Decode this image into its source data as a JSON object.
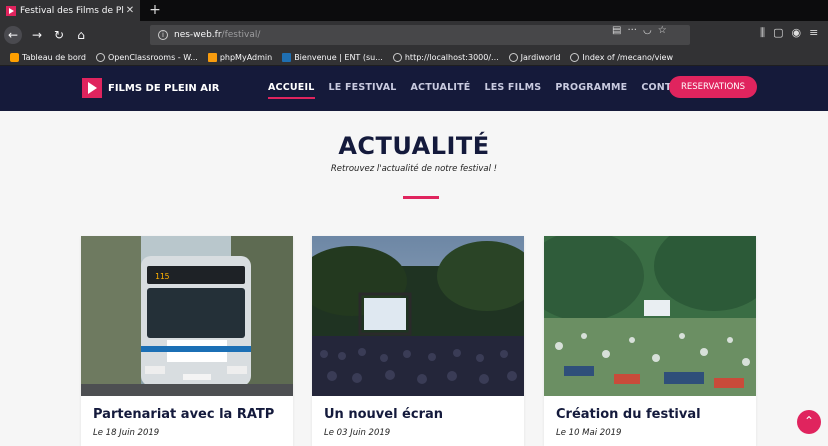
{
  "browser": {
    "tab_title": "Festival des Films de Plein Air",
    "tab_close": "✕",
    "new_tab": "+",
    "url_host": "nes-web.fr",
    "url_path": "/festival/",
    "bookmarks": [
      {
        "label": "Tableau de bord"
      },
      {
        "label": "OpenClassrooms - W..."
      },
      {
        "label": "phpMyAdmin"
      },
      {
        "label": "Bienvenue | ENT (su..."
      },
      {
        "label": "http://localhost:3000/..."
      },
      {
        "label": "Jardiworld"
      },
      {
        "label": "Index of /mecano/view"
      }
    ]
  },
  "site": {
    "logo_text": "FILMS DE PLEIN AIR",
    "menu": [
      {
        "label": "ACCUEIL",
        "active": true
      },
      {
        "label": "LE FESTIVAL"
      },
      {
        "label": "ACTUALITÉ"
      },
      {
        "label": "LES FILMS"
      },
      {
        "label": "PROGRAMME"
      },
      {
        "label": "CONTACT"
      }
    ],
    "reservation_label": "RESERVATIONS"
  },
  "hero": {
    "title": "ACTUALITÉ",
    "subtitle": "Retrouvez l'actualité de notre festival !"
  },
  "articles": [
    {
      "title": "Partenariat avec la RATP",
      "date": "Le 18 Juin 2019"
    },
    {
      "title": "Un nouvel écran",
      "date": "Le 03 Juin 2019"
    },
    {
      "title": "Création du festival",
      "date": "Le 10 Mai 2019"
    }
  ],
  "colors": {
    "accent": "#e0245e",
    "header_bg": "#151a3a",
    "title": "#141a3c"
  }
}
